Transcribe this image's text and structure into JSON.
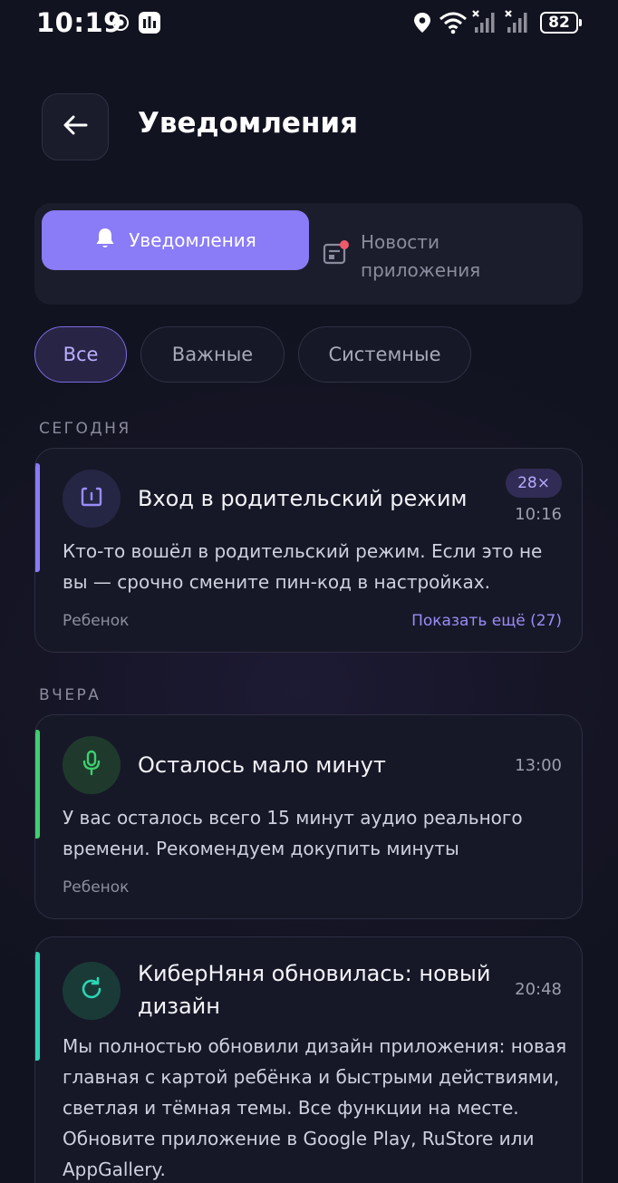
{
  "status_bar": {
    "time": "10:19",
    "battery": "82"
  },
  "header": {
    "title": "Уведомления"
  },
  "segments": {
    "active_label": "Уведомления",
    "inactive_label": "Новости приложения"
  },
  "filters": {
    "all": "Все",
    "important": "Важные",
    "system": "Системные"
  },
  "sections": {
    "today": "СЕГОДНЯ",
    "yesterday": "ВЧЕРА"
  },
  "notifications": [
    {
      "title": "Вход в родительский режим",
      "badge": "28×",
      "time": "10:16",
      "body": "Кто-то вошёл в родительский режим. Если это не вы — срочно смените пин-код в настройках.",
      "tag": "Ребенок",
      "more": "Показать ещё (27)",
      "accent": "#8a7bf7"
    },
    {
      "title": "Осталось мало минут",
      "time": "13:00",
      "body": "У вас осталось всего 15 минут аудио реального времени. Рекомендуем докупить минуты",
      "tag": "Ребенок",
      "accent": "#3ecf6e"
    },
    {
      "title": "КиберНяня обновилась: новый дизайн",
      "time": "20:48",
      "body": "Мы полностью обновили дизайн приложения: новая главная с картой ребёнка и быстрыми действиями, светлая и тёмная темы. Все функции на месте. Обновите приложение в Google Play, RuStore или AppGallery.",
      "accent": "#2bd6b4"
    }
  ],
  "colors": {
    "background": "#121320",
    "accent_purple": "#8a7bf7",
    "accent_green": "#3ecf6e",
    "accent_teal": "#2bd6b4",
    "unread_dot": "#f05a6a"
  }
}
